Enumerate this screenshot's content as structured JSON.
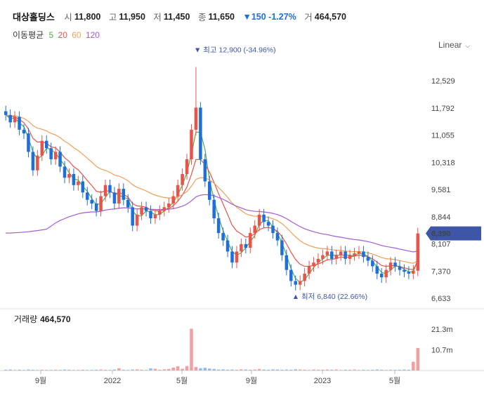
{
  "header": {
    "stock_name": "대상홀딩스",
    "open_label": "시",
    "open": "11,800",
    "high_label": "고",
    "high": "11,950",
    "low_label": "저",
    "low": "11,450",
    "close_label": "종",
    "close": "11,650",
    "change": "▼150 -1.27%",
    "volume_label": "거",
    "volume": "464,570"
  },
  "moving_average": {
    "label": "이동평균",
    "periods": [
      {
        "value": "5",
        "color": "#4caf50"
      },
      {
        "value": "20",
        "color": "#e8534a"
      },
      {
        "value": "60",
        "color": "#f0a05a"
      },
      {
        "value": "120",
        "color": "#a55ad8"
      }
    ]
  },
  "scale_toggle": "Linear",
  "colors": {
    "up": "#e8534a",
    "down": "#1e6fd9",
    "axis_text": "#444444",
    "highlight_badge": "#3d57a6",
    "annotation": "#3d57a6"
  },
  "chart_data": {
    "type": "candlestick",
    "x_tick_labels": [
      "9월",
      "2022",
      "5월",
      "9월",
      "2023",
      "5월"
    ],
    "y_tick_labels": [
      "12,529",
      "11,792",
      "11,055",
      "10,318",
      "9,581",
      "8,844",
      "8,107",
      "7,370",
      "6,633"
    ],
    "y_ticks": [
      12529,
      11792,
      11055,
      10318,
      9581,
      8844,
      8107,
      7370,
      6633
    ],
    "current_price": 8390,
    "current_price_label": "8,390",
    "max_annotation": {
      "text": "최고 12,900 (-34.96%)",
      "value": 12900
    },
    "min_annotation": {
      "text": "최저 6,840 (22.66%)",
      "value": 6840
    },
    "closes": [
      11600,
      11400,
      11550,
      11200,
      11100,
      10600,
      10100,
      10500,
      10900,
      10700,
      10400,
      10600,
      10200,
      9900,
      10000,
      9700,
      9800,
      9500,
      9300,
      9200,
      9000,
      9400,
      9700,
      9500,
      9200,
      9600,
      9300,
      9100,
      8600,
      8900,
      9100,
      9000,
      8800,
      8900,
      9000,
      9100,
      9200,
      9400,
      9700,
      10000,
      10400,
      11200,
      11800,
      10400,
      9800,
      9300,
      8800,
      8400,
      8200,
      7900,
      7600,
      7900,
      8100,
      8000,
      8400,
      8600,
      8900,
      8700,
      8600,
      8400,
      8200,
      7800,
      7400,
      7100,
      7000,
      7100,
      7300,
      7500,
      7600,
      7700,
      7800,
      7900,
      7700,
      7800,
      7900,
      7700,
      7800,
      7850,
      7900,
      7750,
      7650,
      7500,
      7300,
      7200,
      7400,
      7600,
      7500,
      7400,
      7350,
      7300,
      7380,
      8390
    ],
    "volume_ylabels": [
      "21.3m",
      "10.7m"
    ],
    "volume_ticks": [
      21.3,
      10.7
    ],
    "volumes": [
      0.4,
      0.5,
      0.3,
      0.4,
      0.3,
      0.5,
      0.4,
      0.3,
      0.4,
      0.3,
      0.3,
      0.4,
      0.3,
      0.5,
      0.4,
      0.3,
      0.3,
      0.4,
      0.3,
      0.3,
      0.4,
      0.5,
      0.4,
      0.3,
      0.5,
      1.2,
      0.4,
      0.3,
      0.5,
      0.6,
      0.4,
      0.3,
      1.1,
      0.9,
      0.4,
      0.6,
      0.8,
      1.5,
      2.2,
      0.9,
      2.3,
      21.5,
      1.8,
      1.2,
      1.4,
      1.0,
      0.8,
      0.5,
      0.6,
      0.4,
      0.5,
      0.4,
      0.6,
      0.5,
      0.4,
      0.5,
      0.8,
      0.5,
      0.4,
      0.6,
      0.5,
      0.4,
      0.5,
      0.4,
      0.6,
      0.5,
      0.4,
      0.3,
      0.5,
      0.4,
      0.4,
      0.5,
      0.4,
      0.5,
      0.3,
      0.4,
      0.4,
      0.5,
      0.3,
      0.4,
      0.3,
      0.4,
      0.5,
      0.4,
      0.3,
      0.4,
      0.3,
      0.4,
      0.5,
      0.4,
      4.5,
      11.6
    ],
    "volume_label": "거래량",
    "volume_value": "464,570"
  }
}
